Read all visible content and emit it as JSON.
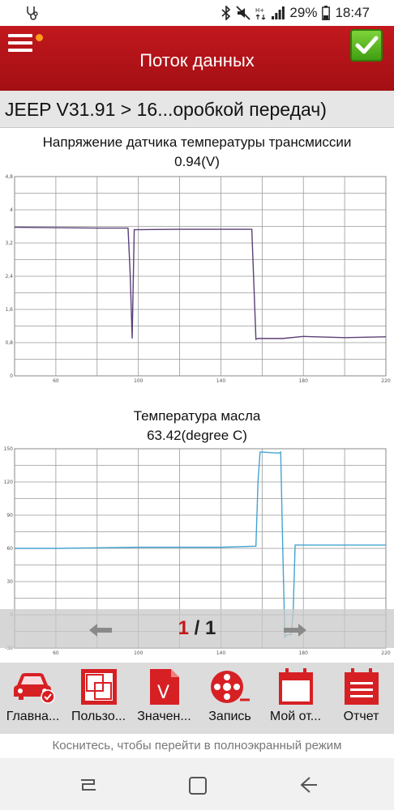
{
  "status": {
    "battery": "29%",
    "time": "18:47"
  },
  "header": {
    "title": "Поток данных"
  },
  "breadcrumb": "JEEP V31.91 > 16...оробкой передач)",
  "chart_data": [
    {
      "type": "line",
      "title": "Напряжение датчика температуры трансмиссии",
      "value_label": "0.94(V)",
      "xlim": [
        40,
        220
      ],
      "ylim": [
        0,
        4.8
      ],
      "x_ticks": [
        60,
        100,
        140,
        180,
        220
      ],
      "y_ticks": [
        0,
        0.8,
        1.6,
        2.4,
        3.2,
        4,
        4.8
      ],
      "y_tick_labels": [
        "0",
        "0,8",
        "1,6",
        "2,4",
        "3,2",
        "4",
        "4,8"
      ],
      "grid": true,
      "color": "#5b3f78",
      "series": [
        {
          "x": [
            40,
            60,
            80,
            95,
            96,
            97,
            98,
            120,
            140,
            155,
            156,
            157,
            158,
            170,
            180,
            200,
            220
          ],
          "y": [
            3.58,
            3.57,
            3.56,
            3.56,
            2.5,
            0.9,
            3.52,
            3.53,
            3.53,
            3.53,
            2.2,
            0.88,
            0.9,
            0.9,
            0.95,
            0.92,
            0.94
          ]
        }
      ]
    },
    {
      "type": "line",
      "title": "Температура масла",
      "value_label": "63.42(degree C)",
      "xlim": [
        40,
        220
      ],
      "ylim": [
        -30,
        150
      ],
      "x_ticks": [
        60,
        100,
        140,
        180,
        220
      ],
      "y_ticks": [
        -30,
        0,
        30,
        60,
        90,
        120,
        150
      ],
      "grid": true,
      "color": "#44a3d0",
      "series": [
        {
          "x": [
            40,
            60,
            100,
            140,
            157,
            158,
            159,
            160,
            168,
            169,
            170,
            171,
            172,
            174,
            175,
            176,
            220
          ],
          "y": [
            60,
            60,
            61,
            61,
            62,
            120,
            147,
            147,
            146,
            147,
            60,
            -20,
            -18,
            -18,
            0,
            63,
            63
          ]
        }
      ]
    }
  ],
  "pager": {
    "current": "1",
    "separator": " / ",
    "total": "1"
  },
  "toolbar": [
    {
      "label": "Главна...",
      "icon": "car-icon"
    },
    {
      "label": "Пользо...",
      "icon": "custom-icon"
    },
    {
      "label": "Значен...",
      "icon": "value-icon"
    },
    {
      "label": "Запись",
      "icon": "record-icon"
    },
    {
      "label": "Мой от...",
      "icon": "calendar-icon"
    },
    {
      "label": "Отчет",
      "icon": "report-icon"
    }
  ],
  "hint": "Коснитесь, чтобы перейти в полноэкранный режим",
  "colors": {
    "header": "#b11418",
    "accent": "#c3161b",
    "ok": "#5fb826"
  }
}
